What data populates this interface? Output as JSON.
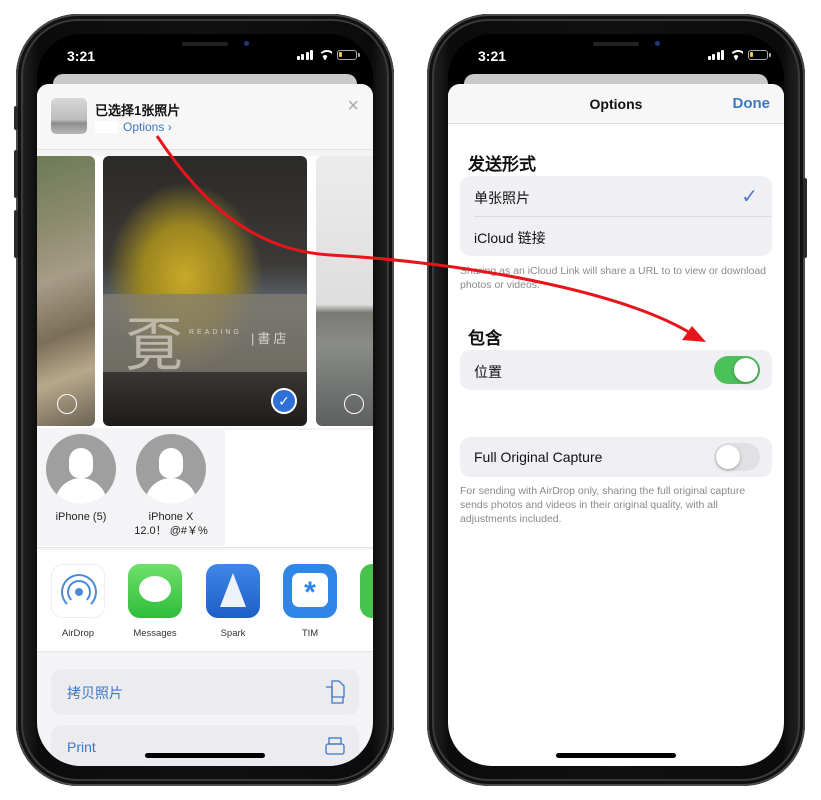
{
  "status_bar": {
    "time": "3:21"
  },
  "share_sheet": {
    "title": "已选择1张照片",
    "options_label": "Options",
    "options_chevron": "›",
    "close_icon": "×",
    "photos": [
      {
        "name": "trees-photo",
        "selected": false
      },
      {
        "name": "bookstore-photo",
        "selected": true,
        "banner_char": "覔",
        "banner_reading": "READING",
        "banner_shop": "|書店"
      },
      {
        "name": "lake-photo",
        "selected": false
      }
    ],
    "check_glyph": "✓",
    "airdrop_people": [
      {
        "name": "iPhone (5)"
      },
      {
        "name": "iPhone X\n12.0！ @#￥%"
      }
    ],
    "apps": [
      {
        "label": "AirDrop",
        "icon": "airdrop-icon"
      },
      {
        "label": "Messages",
        "icon": "messages-icon"
      },
      {
        "label": "Spark",
        "icon": "spark-icon"
      },
      {
        "label": "TIM",
        "icon": "tim-icon"
      }
    ],
    "tim_glyph": "*",
    "actions": [
      {
        "label": "拷贝照片",
        "icon": "copy-icon"
      },
      {
        "label": "Print",
        "icon": "print-icon"
      }
    ]
  },
  "options_sheet": {
    "title": "Options",
    "done_label": "Done",
    "send_as": {
      "heading": "发送形式",
      "items": [
        {
          "label": "单张照片",
          "selected": true
        },
        {
          "label": "iCloud 链接",
          "selected": false
        }
      ],
      "check_glyph": "✓",
      "footnote": "Sharing as an iCloud Link will share a URL to to view or download photos or videos."
    },
    "include": {
      "heading": "包含",
      "location_label": "位置",
      "location_on": true
    },
    "full_capture": {
      "label": "Full Original Capture",
      "on": false,
      "footnote": "For sending with AirDrop only, sharing the full original capture sends photos and videos in their original quality, with all adjustments included."
    }
  },
  "colors": {
    "accent_blue": "#3d78c4",
    "toggle_green": "#4cc05a",
    "annotation_red": "#e8141b"
  }
}
